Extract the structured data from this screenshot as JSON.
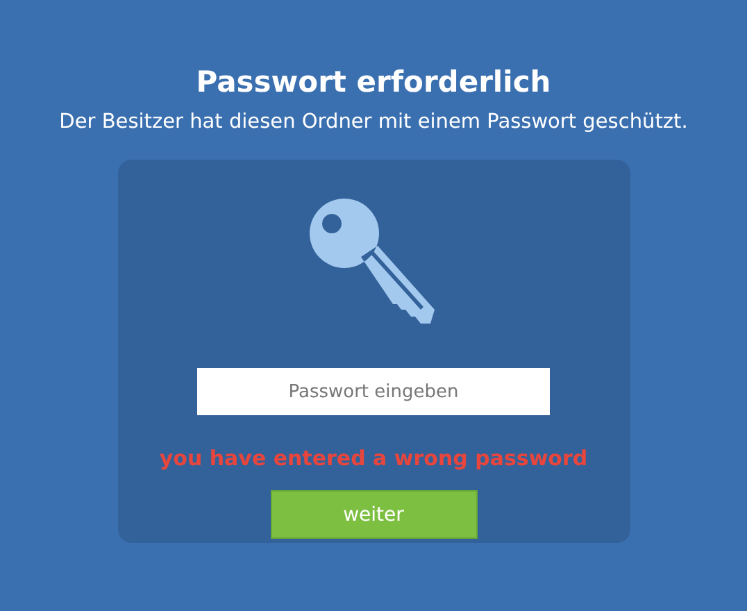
{
  "title": "Passwort erforderlich",
  "subtitle": "Der Besitzer hat diesen Ordner mit einem Passwort geschützt.",
  "password_field": {
    "placeholder": "Passwort eingeben"
  },
  "error": "you have entered a wrong password",
  "submit_button": "weiter"
}
